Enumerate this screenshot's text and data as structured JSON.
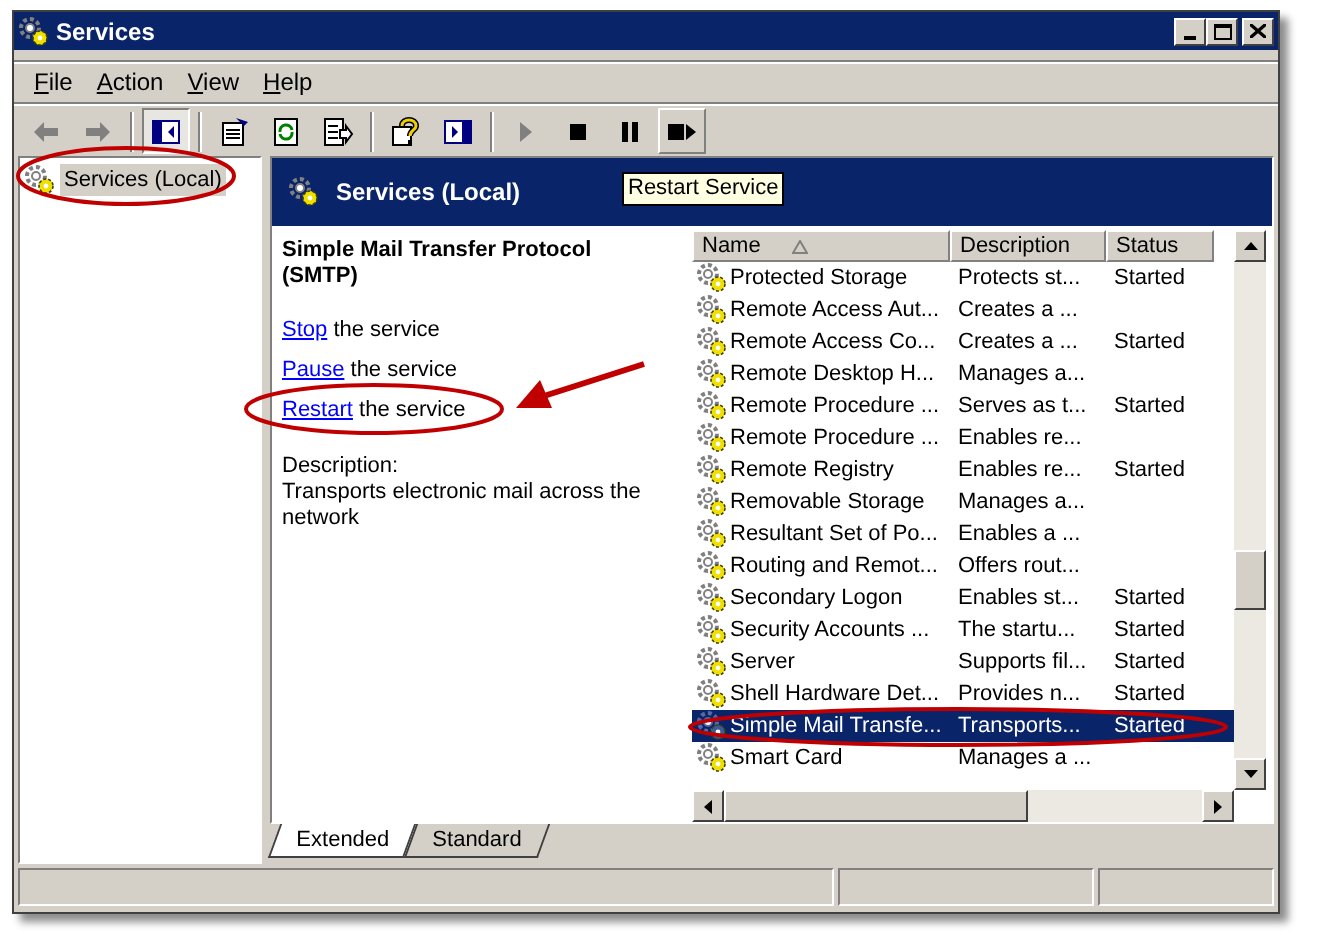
{
  "window": {
    "title": "Services"
  },
  "menu": [
    {
      "label": "File"
    },
    {
      "label": "Action"
    },
    {
      "label": "View"
    },
    {
      "label": "Help"
    }
  ],
  "toolbar": [
    {
      "kind": "back",
      "disabled": true
    },
    {
      "kind": "forward",
      "disabled": true
    },
    {
      "kind": "sep"
    },
    {
      "kind": "tree",
      "pressed": true
    },
    {
      "kind": "sep"
    },
    {
      "kind": "properties"
    },
    {
      "kind": "refresh"
    },
    {
      "kind": "export"
    },
    {
      "kind": "sep"
    },
    {
      "kind": "help"
    },
    {
      "kind": "panel"
    },
    {
      "kind": "sep"
    },
    {
      "kind": "play",
      "disabled": true
    },
    {
      "kind": "stop"
    },
    {
      "kind": "pause"
    },
    {
      "kind": "restart",
      "hover": true
    }
  ],
  "tooltip": "Restart Service",
  "tree": [
    {
      "label": "Services (Local)",
      "selected": true
    }
  ],
  "header": {
    "title": "Services (Local)"
  },
  "details": {
    "title": "Simple Mail Transfer Protocol (SMTP)",
    "actions": [
      {
        "link": "Stop",
        "rest": " the service"
      },
      {
        "link": "Pause",
        "rest": " the service"
      },
      {
        "link": "Restart",
        "rest": " the service"
      }
    ],
    "description_label": "Description:",
    "description": "Transports electronic mail across the network"
  },
  "table": {
    "columns": [
      {
        "label": "Name",
        "sorted": true
      },
      {
        "label": "Description"
      },
      {
        "label": "Status"
      }
    ],
    "rows": [
      {
        "name": "Protected Storage",
        "description": "Protects st...",
        "status": "Started",
        "selected": false
      },
      {
        "name": "Remote Access Aut...",
        "description": "Creates a ...",
        "selected": false
      },
      {
        "name": "Remote Access Co...",
        "description": "Creates a ...",
        "status": "Started",
        "selected": false
      },
      {
        "name": "Remote Desktop H...",
        "description": "Manages a...",
        "selected": false
      },
      {
        "name": "Remote Procedure ...",
        "description": "Serves as t...",
        "status": "Started",
        "selected": false
      },
      {
        "name": "Remote Procedure ...",
        "description": "Enables re...",
        "selected": false
      },
      {
        "name": "Remote Registry",
        "description": "Enables re...",
        "status": "Started",
        "selected": false
      },
      {
        "name": "Removable Storage",
        "description": "Manages a...",
        "selected": false
      },
      {
        "name": "Resultant Set of Po...",
        "description": "Enables a ...",
        "selected": false
      },
      {
        "name": "Routing and Remot...",
        "description": "Offers rout...",
        "selected": false
      },
      {
        "name": "Secondary Logon",
        "description": "Enables st...",
        "status": "Started",
        "selected": false
      },
      {
        "name": "Security Accounts ...",
        "description": "The startu...",
        "status": "Started",
        "selected": false
      },
      {
        "name": "Server",
        "description": "Supports fil...",
        "status": "Started",
        "selected": false
      },
      {
        "name": "Shell Hardware Det...",
        "description": "Provides n...",
        "status": "Started",
        "selected": false
      },
      {
        "name": "Simple Mail Transfe...",
        "description": "Transports...",
        "status": "Started",
        "selected": true
      },
      {
        "name": "Smart Card",
        "description": "Manages a ...",
        "selected": false
      }
    ]
  },
  "tabs": [
    {
      "label": "Extended",
      "selected": true
    },
    {
      "label": "Standard",
      "selected": false
    }
  ]
}
